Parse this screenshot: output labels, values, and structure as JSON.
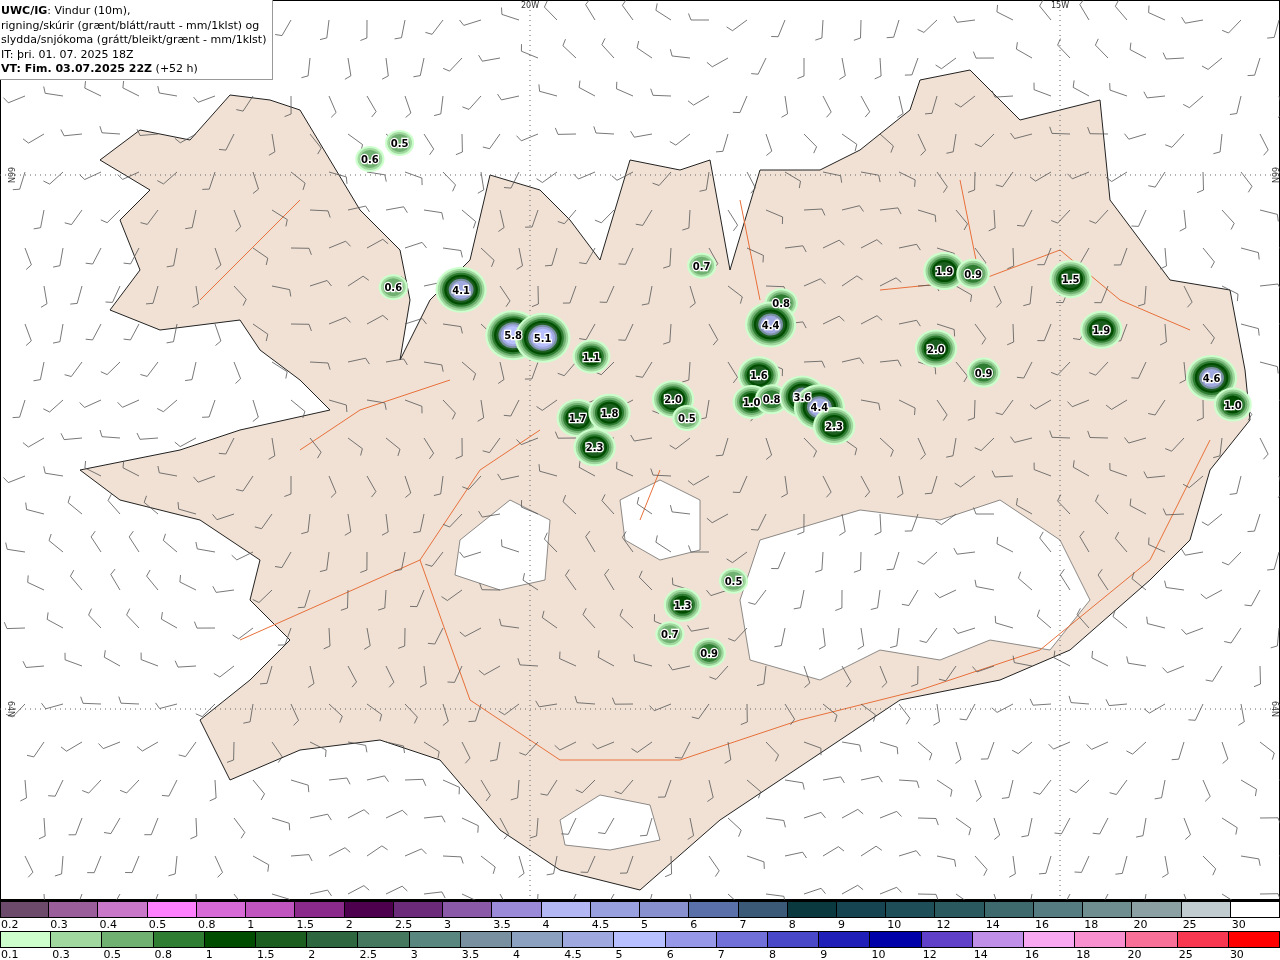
{
  "legend": {
    "lines": [
      "**UWC/IG**: Vindur (10m),",
      "rigning/skúrir (grænt/blátt/rautt - mm/1klst) og",
      "slydda/snjókoma (grátt/bleikt/grænt - mm/1klst)",
      "IT: þri. 01. 07. 2025 18Z",
      "**VT: Fim. 03.07.2025 22Z** (+52 h)"
    ]
  },
  "graticule": {
    "meridians": [
      {
        "label": "20W"
      },
      {
        "label": "15W"
      }
    ],
    "parallels": [
      {
        "label_left": "66N",
        "label_right": "66N"
      },
      {
        "label_left": "64N",
        "label_right": "64N"
      }
    ]
  },
  "precipitation_cells": [
    {
      "value": "0.5"
    },
    {
      "value": "0.6"
    },
    {
      "value": "0.7"
    },
    {
      "value": "1.9"
    },
    {
      "value": "0.9"
    },
    {
      "value": "1.5"
    },
    {
      "value": "0.6"
    },
    {
      "value": "4.1"
    },
    {
      "value": "0.8"
    },
    {
      "value": "4.4"
    },
    {
      "value": "1.9"
    },
    {
      "value": "5.8"
    },
    {
      "value": "5.1"
    },
    {
      "value": "2.0"
    },
    {
      "value": "1.1"
    },
    {
      "value": "0.9"
    },
    {
      "value": "1.6"
    },
    {
      "value": "4.6"
    },
    {
      "value": "2.0"
    },
    {
      "value": "1.0"
    },
    {
      "value": "0.8"
    },
    {
      "value": "3.6"
    },
    {
      "value": "4.4"
    },
    {
      "value": "1.0"
    },
    {
      "value": "1.7"
    },
    {
      "value": "1.8"
    },
    {
      "value": "0.5"
    },
    {
      "value": "2.3"
    },
    {
      "value": "2.3"
    },
    {
      "value": "0.5"
    },
    {
      "value": "1.3"
    },
    {
      "value": "0.7"
    },
    {
      "value": "0.9"
    }
  ],
  "colorbars": [
    {
      "bins": [
        {
          "label": "0.2",
          "color": "#6b4a6b"
        },
        {
          "label": "0.3",
          "color": "#9a5f9a"
        },
        {
          "label": "0.4",
          "color": "#c978c9"
        },
        {
          "label": "0.5",
          "color": "#ff80ff"
        },
        {
          "label": "0.8",
          "color": "#d86ad8"
        },
        {
          "label": "1",
          "color": "#c055c0"
        },
        {
          "label": "1.5",
          "color": "#8b2a8b"
        },
        {
          "label": "2",
          "color": "#4d004d"
        },
        {
          "label": "2.5",
          "color": "#6b2a7a"
        },
        {
          "label": "3",
          "color": "#8a5aa8"
        },
        {
          "label": "3.5",
          "color": "#9a8ad8"
        },
        {
          "label": "4",
          "color": "#b3b8f5"
        },
        {
          "label": "4.5",
          "color": "#98a0e0"
        },
        {
          "label": "5",
          "color": "#8890d0"
        },
        {
          "label": "6",
          "color": "#5a70a8"
        },
        {
          "label": "7",
          "color": "#3a5a78"
        },
        {
          "label": "8",
          "color": "#0a3a40"
        },
        {
          "label": "9",
          "color": "#164450"
        },
        {
          "label": "10",
          "color": "#1e4e58"
        },
        {
          "label": "12",
          "color": "#2a5a60"
        },
        {
          "label": "14",
          "color": "#3e6a6e"
        },
        {
          "label": "16",
          "color": "#557c80"
        },
        {
          "label": "18",
          "color": "#6e8e90"
        },
        {
          "label": "20",
          "color": "#8aa0a2"
        },
        {
          "label": "25",
          "color": "#c0ccd0"
        },
        {
          "label": "30",
          "color": "#ffffff"
        }
      ]
    },
    {
      "bins": [
        {
          "label": "0.1",
          "color": "#ccffcc"
        },
        {
          "label": "0.3",
          "color": "#a0d8a0"
        },
        {
          "label": "0.5",
          "color": "#70b070"
        },
        {
          "label": "0.8",
          "color": "#2e7d32"
        },
        {
          "label": "1",
          "color": "#004d00"
        },
        {
          "label": "1.5",
          "color": "#1b5e20"
        },
        {
          "label": "2",
          "color": "#2e6640"
        },
        {
          "label": "2.5",
          "color": "#467860"
        },
        {
          "label": "3",
          "color": "#5a8680"
        },
        {
          "label": "3.5",
          "color": "#7890a0"
        },
        {
          "label": "4",
          "color": "#8ca0c0"
        },
        {
          "label": "4.5",
          "color": "#a0a8e0"
        },
        {
          "label": "5",
          "color": "#b8c0ff"
        },
        {
          "label": "6",
          "color": "#9898e8"
        },
        {
          "label": "7",
          "color": "#7070d8"
        },
        {
          "label": "8",
          "color": "#4848c8"
        },
        {
          "label": "9",
          "color": "#2020b8"
        },
        {
          "label": "10",
          "color": "#0000a8"
        },
        {
          "label": "12",
          "color": "#6040c8"
        },
        {
          "label": "14",
          "color": "#c090e8"
        },
        {
          "label": "16",
          "color": "#f8a8f0"
        },
        {
          "label": "18",
          "color": "#f890d0"
        },
        {
          "label": "20",
          "color": "#f87098"
        },
        {
          "label": "25",
          "color": "#f83850"
        },
        {
          "label": "30",
          "color": "#ff0000"
        }
      ]
    }
  ]
}
